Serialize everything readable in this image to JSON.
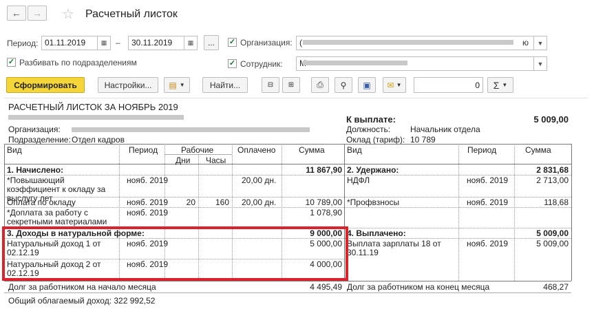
{
  "window": {
    "title": "Расчетный листок"
  },
  "filters": {
    "period_label": "Период:",
    "date_from": "01.11.2019",
    "dash": "–",
    "date_to": "30.11.2019",
    "period_more": "...",
    "org_label": "Организация:",
    "org_value_prefix": "(",
    "org_value_suffix": "ю",
    "split_label": "Разбивать по подразделениям",
    "emp_label": "Сотрудник:",
    "emp_value_prefix": "М"
  },
  "toolbar": {
    "generate": "Сформировать",
    "settings": "Настройки...",
    "find": "Найти...",
    "amount": "0",
    "sum_symbol": "Σ"
  },
  "report": {
    "title": "РАСЧЕТНЫЙ ЛИСТОК ЗА НОЯБРЬ 2019",
    "org_label": "Организация:",
    "dept_label": "Подразделение:",
    "dept_value": "Отдел кадров",
    "to_pay_label": "К выплате:",
    "to_pay_value": "5 009,00",
    "position_label": "Должность:",
    "position_value": "Начальник отдела",
    "salary_label": "Оклад (тариф):",
    "salary_value": "10 789",
    "headers": {
      "kind": "Вид",
      "period": "Период",
      "working": "Рабочие",
      "days": "Дни",
      "hours": "Часы",
      "paid": "Оплачено",
      "sum": "Сумма",
      "kind2": "Вид",
      "period2": "Период",
      "sum2": "Сумма"
    },
    "accrued": {
      "title": "1. Начислено:",
      "total": "11 867,90",
      "rows": [
        {
          "kind": "*Повышающий коэффициент к окладу за выслугу лет",
          "period": "нояб. 2019",
          "days": "",
          "hours": "",
          "paid": "20,00 дн.",
          "sum": ""
        },
        {
          "kind": "Оплата по окладу",
          "period": "нояб. 2019",
          "days": "20",
          "hours": "160",
          "paid": "20,00 дн.",
          "sum": "10 789,00"
        },
        {
          "kind": "*Доплата за работу с секретными материалами",
          "period": "нояб. 2019",
          "days": "",
          "hours": "",
          "paid": "",
          "sum": "1 078,90"
        }
      ]
    },
    "withheld": {
      "title": "2. Удержано:",
      "total": "2 831,68",
      "rows": [
        {
          "kind": "НДФЛ",
          "period": "нояб. 2019",
          "sum": "2 713,00"
        },
        {
          "kind": "*Профвзносы",
          "period": "нояб. 2019",
          "sum": "118,68"
        }
      ]
    },
    "natural": {
      "title": "3. Доходы в натуральной форме:",
      "total": "9 000,00",
      "rows": [
        {
          "kind": "Натуральный доход 1 от 02.12.19",
          "period": "нояб. 2019",
          "sum": "5 000,00"
        },
        {
          "kind": "Натуральный доход 2 от 02.12.19",
          "period": "нояб. 2019",
          "sum": "4 000,00"
        }
      ]
    },
    "paid": {
      "title": "4. Выплачено:",
      "total": "5 009,00",
      "rows": [
        {
          "kind": "Выплата зарплаты 18 от 30.11.19",
          "period": "нояб. 2019",
          "sum": "5 009,00"
        }
      ]
    },
    "debt_start_label": "Долг за работником на начало месяца",
    "debt_start_value": "4 495,49",
    "debt_end_label": "Долг за работником на конец месяца",
    "debt_end_value": "468,27",
    "taxable_label": "Общий облагаемый доход: 322 992,52"
  },
  "colors": {
    "highlight": "#d9232d",
    "generate_bg": "#f5d63a",
    "check": "#0a7a2a"
  }
}
